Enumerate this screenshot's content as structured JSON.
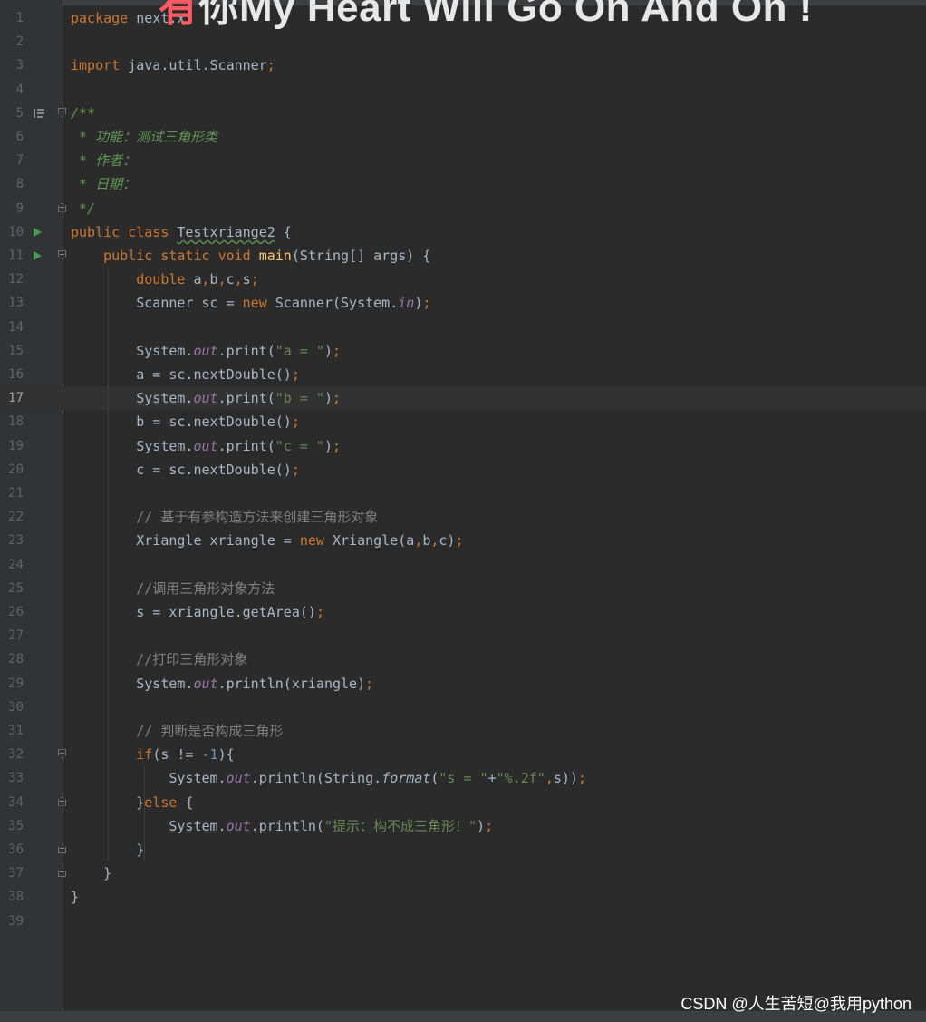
{
  "overlay": {
    "lyric_prefix": "有",
    "lyric_rest": "你My Heart Will Go On And On !"
  },
  "editor": {
    "current_line": 17,
    "lines": [
      {
        "n": "1",
        "code": "package next.x;"
      },
      {
        "n": "2",
        "code": ""
      },
      {
        "n": "3",
        "code": "import java.util.Scanner;"
      },
      {
        "n": "4",
        "code": ""
      },
      {
        "n": "5",
        "code": "/**"
      },
      {
        "n": "6",
        "code": " * 功能：测试三角形类"
      },
      {
        "n": "7",
        "code": " * 作者："
      },
      {
        "n": "8",
        "code": " * 日期："
      },
      {
        "n": "9",
        "code": " */"
      },
      {
        "n": "10",
        "code": "public class Testxriange2 {"
      },
      {
        "n": "11",
        "code": "    public static void main(String[] args) {"
      },
      {
        "n": "12",
        "code": "        double a,b,c,s;"
      },
      {
        "n": "13",
        "code": "        Scanner sc = new Scanner(System.in);"
      },
      {
        "n": "14",
        "code": ""
      },
      {
        "n": "15",
        "code": "        System.out.print(\"a = \");"
      },
      {
        "n": "16",
        "code": "        a = sc.nextDouble();"
      },
      {
        "n": "17",
        "code": "        System.out.print(\"b = \");"
      },
      {
        "n": "18",
        "code": "        b = sc.nextDouble();"
      },
      {
        "n": "19",
        "code": "        System.out.print(\"c = \");"
      },
      {
        "n": "20",
        "code": "        c = sc.nextDouble();"
      },
      {
        "n": "21",
        "code": ""
      },
      {
        "n": "22",
        "code": "        // 基于有参构造方法来创建三角形对象"
      },
      {
        "n": "23",
        "code": "        Xriangle xriangle = new Xriangle(a,b,c);"
      },
      {
        "n": "24",
        "code": ""
      },
      {
        "n": "25",
        "code": "        //调用三角形对象方法"
      },
      {
        "n": "26",
        "code": "        s = xriangle.getArea();"
      },
      {
        "n": "27",
        "code": ""
      },
      {
        "n": "28",
        "code": "        //打印三角形对象"
      },
      {
        "n": "29",
        "code": "        System.out.println(xriangle);"
      },
      {
        "n": "30",
        "code": ""
      },
      {
        "n": "31",
        "code": "        // 判断是否构成三角形"
      },
      {
        "n": "32",
        "code": "        if(s != -1){"
      },
      {
        "n": "33",
        "code": "            System.out.println(String.format(\"s = \"+\"%.2f\",s));"
      },
      {
        "n": "34",
        "code": "        }else {"
      },
      {
        "n": "35",
        "code": "            System.out.println(\"提示：构不成三角形！\");"
      },
      {
        "n": "36",
        "code": "        }"
      },
      {
        "n": "37",
        "code": "    }"
      },
      {
        "n": "38",
        "code": "}"
      },
      {
        "n": "39",
        "code": ""
      }
    ]
  },
  "gutter_icons": {
    "run_lines": [
      10,
      11
    ],
    "doc_marker_lines": [
      5
    ],
    "fold_start_lines": [
      5,
      11,
      32
    ],
    "fold_end_lines": [
      9,
      34,
      36,
      37
    ]
  },
  "syntax_colors": {
    "keyword": "#cc7832",
    "string": "#6a8759",
    "number": "#6897bb",
    "comment": "#808080",
    "doc_comment": "#629755",
    "static_field": "#9876aa",
    "method_decl": "#ffc66d",
    "plain": "#a9b7c6"
  },
  "watermark": "CSDN @人生苦短@我用python"
}
